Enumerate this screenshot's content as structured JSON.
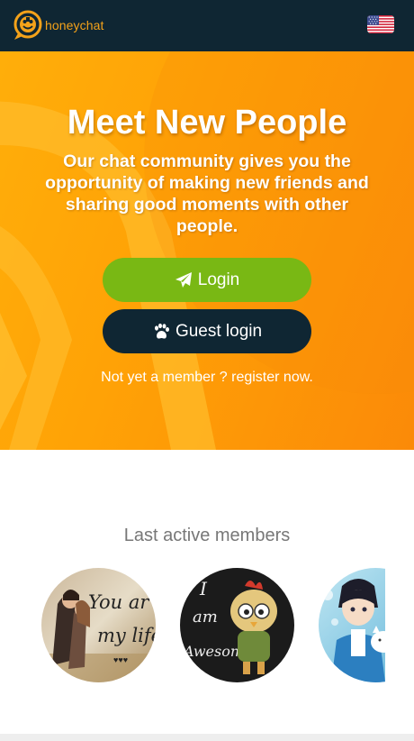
{
  "header": {
    "brand_name": "honeychat",
    "language_flag": "us-flag-icon"
  },
  "hero": {
    "title": "Meet New People",
    "subtitle": "Our chat community gives you the opportunity of making new friends and sharing good moments with other people.",
    "login_label": "Login",
    "guest_label": "Guest login",
    "register_text": "Not yet a member ? register now.",
    "colors": {
      "orange": "#ffa206",
      "login_green": "#79b814",
      "dark_navy": "#0f2633"
    }
  },
  "members": {
    "title": "Last active members",
    "avatars": [
      {
        "name": "member-avatar-couple",
        "text_lines": [
          "You ar",
          "my life"
        ]
      },
      {
        "name": "member-avatar-chicken",
        "text_lines": [
          "I",
          "am",
          "Awesome"
        ]
      },
      {
        "name": "member-avatar-anime",
        "text_lines": []
      }
    ]
  }
}
